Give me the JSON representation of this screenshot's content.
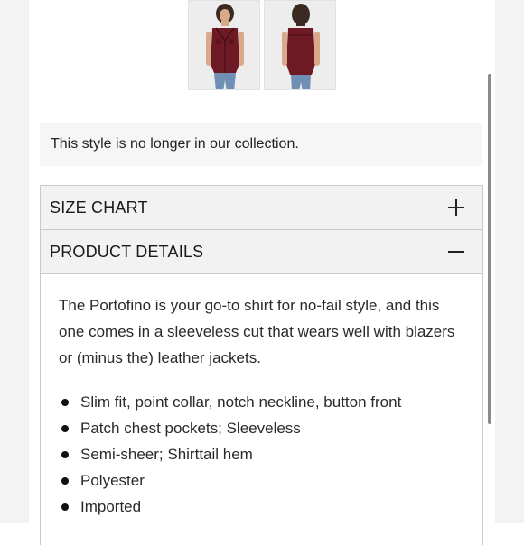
{
  "gallery": {
    "images": [
      {
        "icon": "model-front-view"
      },
      {
        "icon": "model-back-view"
      }
    ],
    "shirt_color": "#6e1a24",
    "jeans_color": "#6f8fb5"
  },
  "notice": {
    "text": "This style is no longer in our collection."
  },
  "accordion": {
    "size_chart": {
      "label": "SIZE CHART",
      "icon": "plus-icon"
    },
    "product_details": {
      "label": "PRODUCT DETAILS",
      "icon": "minus-icon",
      "description": "The Portofino is your go-to shirt for no-fail style, and this one comes in a sleeveless cut that wears well with blazers or (minus the) leather jackets.",
      "bullets": [
        "Slim fit, point collar, notch neckline, button front",
        "Patch chest pockets; Sleeveless",
        "Semi-sheer; Shirttail hem",
        "Polyester",
        "Imported"
      ]
    }
  }
}
